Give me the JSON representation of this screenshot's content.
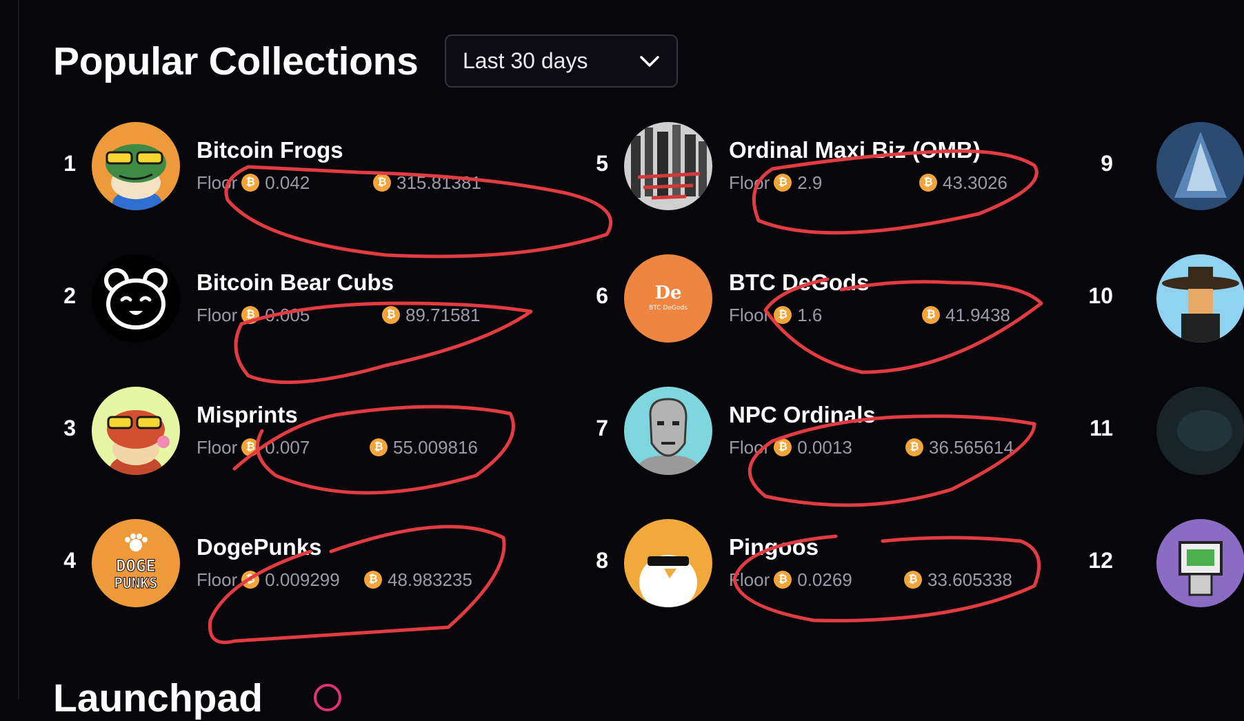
{
  "page_title": "Popular Collections",
  "time_range": {
    "selected": "Last 30 days",
    "icon": "chevron-down-icon"
  },
  "currency_icon": "bitcoin-icon",
  "currency_glyph": "₿",
  "accent_btc": "#f2a53a",
  "annotation_color": "#e23c43",
  "floor_label": "Floor",
  "collections": [
    {
      "rank": "1",
      "name": "Bitcoin Frogs",
      "floor": "0.042",
      "volume": "315.81381"
    },
    {
      "rank": "2",
      "name": "Bitcoin Bear Cubs",
      "floor": "0.005",
      "volume": "89.71581"
    },
    {
      "rank": "3",
      "name": "Misprints",
      "floor": "0.007",
      "volume": "55.009816"
    },
    {
      "rank": "4",
      "name": "DogePunks",
      "floor": "0.009299",
      "volume": "48.983235"
    },
    {
      "rank": "5",
      "name": "Ordinal Maxi Biz (OMB)",
      "floor": "2.9",
      "volume": "43.3026"
    },
    {
      "rank": "6",
      "name": "BTC DeGods",
      "floor": "1.6",
      "volume": "41.9438"
    },
    {
      "rank": "7",
      "name": "NPC Ordinals",
      "floor": "0.0013",
      "volume": "36.565614"
    },
    {
      "rank": "8",
      "name": "Pingoos",
      "floor": "0.0269",
      "volume": "33.605338"
    },
    {
      "rank": "9"
    },
    {
      "rank": "10"
    },
    {
      "rank": "11"
    },
    {
      "rank": "12"
    }
  ],
  "avatar_text": {
    "degods_mark": "De",
    "degods_sub": "BTC DeGods",
    "dogepunks_line1": "DOGE",
    "dogepunks_line2": "PUNKS"
  },
  "next_section_title": "Launchpad"
}
